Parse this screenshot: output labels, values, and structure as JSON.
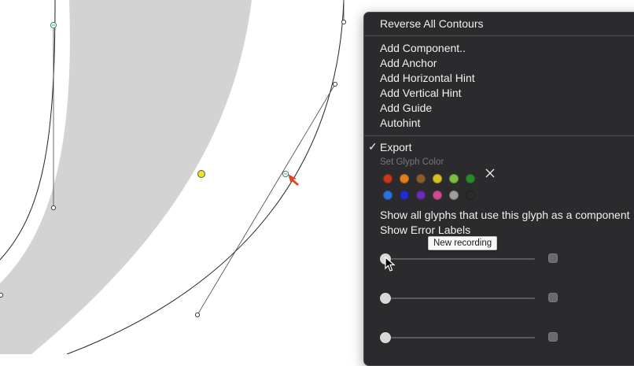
{
  "menu": {
    "reverse_contours": "Reverse All Contours",
    "add_component": "Add Component..",
    "add_anchor": "Add Anchor",
    "add_horizontal_hint": "Add Horizontal Hint",
    "add_vertical_hint": "Add Vertical Hint",
    "add_guide": "Add Guide",
    "autohint": "Autohint",
    "export_check": "✓",
    "export": "Export",
    "set_glyph_color": "Set Glyph Color",
    "show_all_glyphs": "Show all glyphs that use this glyph as a component",
    "show_error_labels": "Show Error Labels"
  },
  "glyph_colors": {
    "row1": [
      "#c8371a",
      "#e07f1e",
      "#8a5c2e",
      "#d9c220",
      "#7bc043",
      "#2a8a2a"
    ],
    "row2": [
      "#2a72d8",
      "#1f2fd0",
      "#6b2ab8",
      "#d04a96",
      "#9e9e9e",
      "#2b2b2d"
    ],
    "clear_icon": "close-icon"
  },
  "sliders": [
    {
      "value": 0,
      "checked": false
    },
    {
      "value": 0,
      "checked": false
    },
    {
      "value": 0,
      "checked": false
    }
  ],
  "tooltip": "New recording",
  "colors": {
    "glyph_fill": "#d3d3d3",
    "menu_bg": "#2b2b2d",
    "selected_node": "#f2e12a",
    "marker": "#e0452a"
  }
}
